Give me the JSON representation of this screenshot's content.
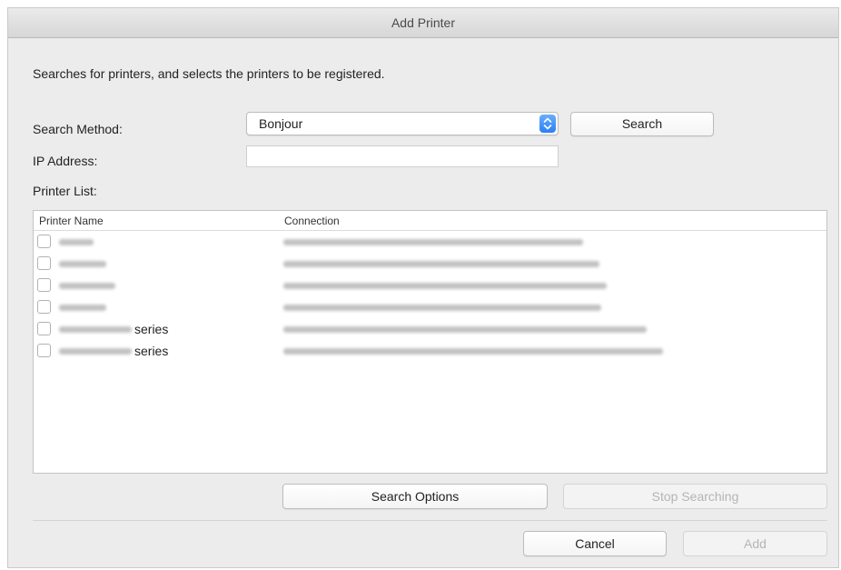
{
  "window": {
    "title": "Add Printer"
  },
  "description": "Searches for printers, and selects the printers to be registered.",
  "search_method": {
    "label": "Search Method:",
    "value": "Bonjour"
  },
  "search_button": "Search",
  "ip_address": {
    "label": "IP Address:",
    "value": ""
  },
  "printer_list": {
    "label": "Printer List:",
    "columns": [
      "Printer Name",
      "Connection"
    ],
    "rows": [
      {
        "name_suffix": "",
        "checked": false
      },
      {
        "name_suffix": "",
        "checked": false
      },
      {
        "name_suffix": "",
        "checked": false
      },
      {
        "name_suffix": "",
        "checked": false
      },
      {
        "name_suffix": "series",
        "checked": false
      },
      {
        "name_suffix": "series",
        "checked": false
      }
    ]
  },
  "buttons": {
    "search_options": "Search Options",
    "stop_searching": "Stop Searching",
    "cancel": "Cancel",
    "add": "Add"
  }
}
